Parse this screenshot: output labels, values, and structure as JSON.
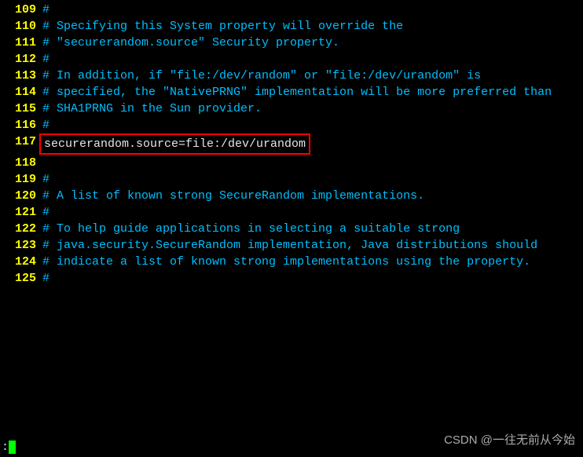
{
  "lines": [
    {
      "num": "109",
      "parts": [
        {
          "t": "#",
          "c": "comment"
        }
      ]
    },
    {
      "num": "110",
      "parts": [
        {
          "t": "# Specifying this System property will override the",
          "c": "comment"
        }
      ]
    },
    {
      "num": "111",
      "parts": [
        {
          "t": "# \"securerandom.source\" Security property.",
          "c": "comment"
        }
      ]
    },
    {
      "num": "112",
      "parts": [
        {
          "t": "#",
          "c": "comment"
        }
      ]
    },
    {
      "num": "113",
      "parts": [
        {
          "t": "# In addition, if \"file:/dev/random\" or \"file:/dev/urandom\" is",
          "c": "comment"
        }
      ]
    },
    {
      "num": "114",
      "parts": [
        {
          "t": "# specified, the \"NativePRNG\" implementation will be more preferred than",
          "c": "comment"
        }
      ]
    },
    {
      "num": "115",
      "parts": [
        {
          "t": "# SHA1PRNG in the Sun provider.",
          "c": "comment"
        }
      ]
    },
    {
      "num": "116",
      "parts": [
        {
          "t": "#",
          "c": "comment"
        }
      ]
    },
    {
      "num": "117",
      "parts": [
        {
          "t": "securerandom.source=file:/dev/urandom",
          "c": "normal",
          "hl": true
        }
      ]
    },
    {
      "num": "118",
      "parts": [
        {
          "t": "",
          "c": "normal"
        }
      ]
    },
    {
      "num": "119",
      "parts": [
        {
          "t": "#",
          "c": "comment"
        }
      ]
    },
    {
      "num": "120",
      "parts": [
        {
          "t": "# A list of known strong SecureRandom implementations.",
          "c": "comment"
        }
      ]
    },
    {
      "num": "121",
      "parts": [
        {
          "t": "#",
          "c": "comment"
        }
      ]
    },
    {
      "num": "122",
      "parts": [
        {
          "t": "# To help guide applications in selecting a suitable strong",
          "c": "comment"
        }
      ]
    },
    {
      "num": "123",
      "parts": [
        {
          "t": "# java.security.SecureRandom implementation, Java distributions should",
          "c": "comment"
        }
      ]
    },
    {
      "num": "124",
      "parts": [
        {
          "t": "# indicate a list of known strong implementations using the property.",
          "c": "comment"
        }
      ]
    },
    {
      "num": "125",
      "parts": [
        {
          "t": "#",
          "c": "comment"
        }
      ]
    }
  ],
  "status_prompt": ":",
  "watermark": "CSDN @一往无前从今始"
}
